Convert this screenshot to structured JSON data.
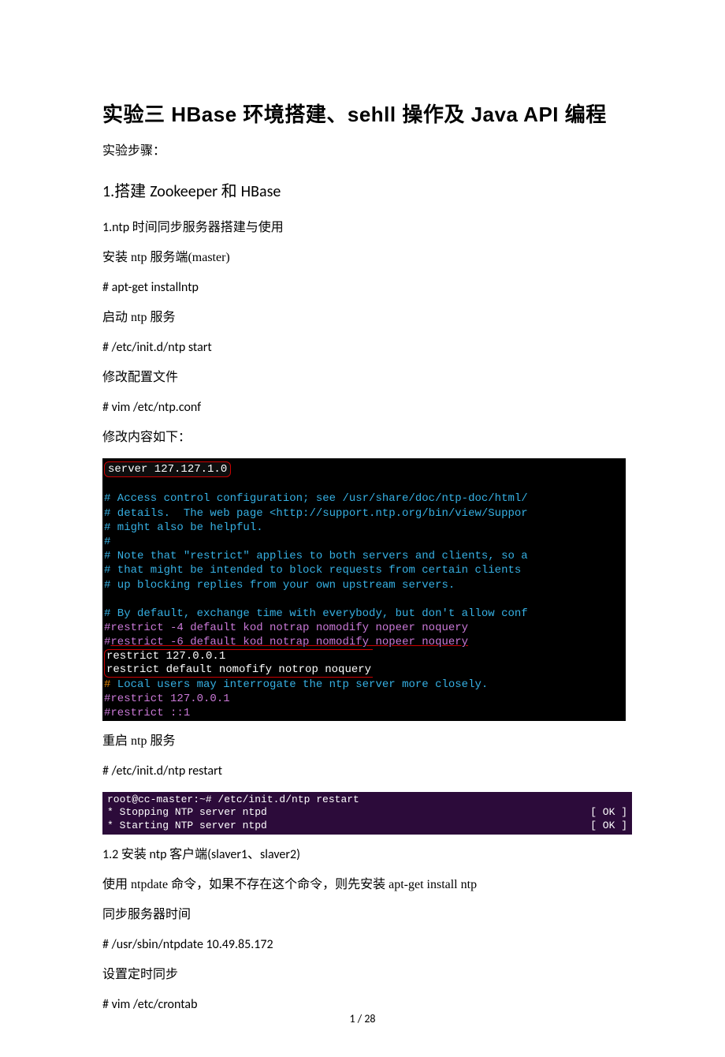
{
  "title": "实验三 HBase 环境搭建、sehll 操作及 Java API 编程",
  "steps_label": "实验步骤：",
  "section1": {
    "num": "1.",
    "cn": "搭建 ",
    "en1": "Zookeeper ",
    "cn2": "和 ",
    "en2": "HBase"
  },
  "p1": "1.ntp 时间同步服务器搭建与使用",
  "p2": "安装 ntp 服务端(master)",
  "p3": "# apt-get installntp",
  "p4": "启动 ntp 服务",
  "p5": "# /etc/init.d/ntp start",
  "p6": "修改配置文件",
  "p7": "# vim /etc/ntp.conf",
  "p8": "修改内容如下：",
  "term1": {
    "server": "server 127.127.1.0",
    "l1": "# Access control configuration; see /usr/share/doc/ntp-doc/html/",
    "l2": "# details.  The web page <http://support.ntp.org/bin/view/Suppor",
    "l3": "# might also be helpful.",
    "l4": "#",
    "l5": "# Note that \"restrict\" applies to both servers and clients, so a",
    "l6": "# that might be intended to block requests from certain clients ",
    "l7": "# up blocking replies from your own upstream servers.",
    "l8": "# By default, exchange time with everybody, but don't allow conf",
    "l9a": "#restrict -4 default kod notrap nomodify nopeer noquery",
    "l9b_pre": "#",
    "l9b_under": "restrict -6 default kod notrap nomodify nopeer noquery",
    "r1": "restrict 127.0.0.1",
    "r2": "restrict default nomofify notrop noquery",
    "l10": " Local users may interrogate the ntp server more closely.",
    "l11": "#restrict 127.0.0.1",
    "l12": "#restrict ::1"
  },
  "p9": "重启 ntp 服务",
  "p10": "# /etc/init.d/ntp restart",
  "term2": {
    "l1": "root@cc-master:~# /etc/init.d/ntp restart",
    "l2": " * Stopping NTP server ntpd",
    "l2r": "[ OK ]",
    "l3": " * Starting NTP server ntpd",
    "l3r": "[ OK ]"
  },
  "p11": "1.2 安装 ntp 客户端(slaver1、slaver2)",
  "p12": "使用 ntpdate 命令，如果不存在这个命令，则先安装 apt-get install ntp",
  "p13": "同步服务器时间",
  "p14": "# /usr/sbin/ntpdate 10.49.85.172",
  "p15": "设置定时同步",
  "p16": "# vim /etc/crontab",
  "pagenum": "1  /  28"
}
